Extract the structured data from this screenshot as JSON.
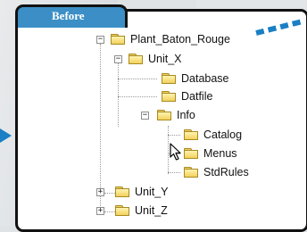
{
  "tab_title": "Before",
  "tree": {
    "root": "Plant_Baton_Rouge",
    "unit_x": "Unit_X",
    "database": "Database",
    "datfile": "Datfile",
    "info": "Info",
    "catalog": "Catalog",
    "menus": "Menus",
    "stdrules": "StdRules",
    "unit_y": "Unit_Y",
    "unit_z": "Unit_Z"
  },
  "colors": {
    "tab": "#3b8fc6",
    "accent": "#1a7fc4",
    "folder": "#f3d25c"
  }
}
